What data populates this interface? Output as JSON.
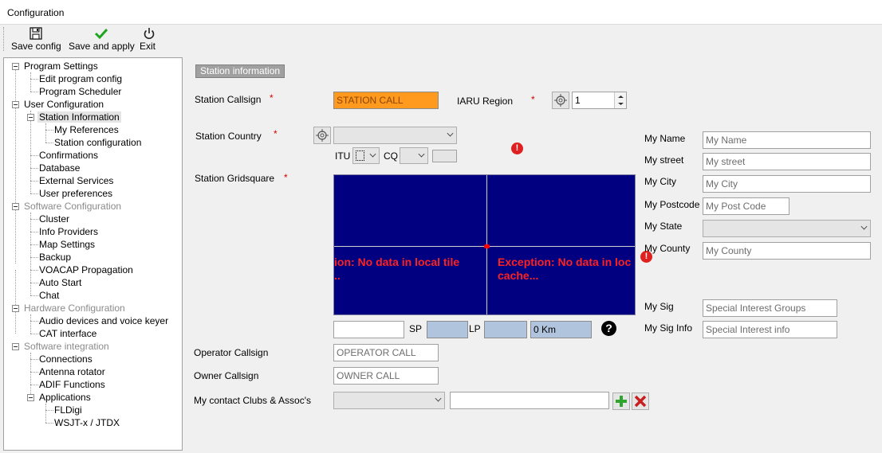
{
  "window": {
    "title": "Configuration"
  },
  "toolbar": {
    "save_config": "Save config",
    "save_apply": "Save and apply",
    "exit": "Exit"
  },
  "tree": {
    "program_settings": "Program Settings",
    "edit_program_config": "Edit program config",
    "program_scheduler": "Program Scheduler",
    "user_configuration": "User Configuration",
    "station_information": "Station Information",
    "my_references": "My References",
    "station_configuration": "Station configuration",
    "confirmations": "Confirmations",
    "database": "Database",
    "external_services": "External Services",
    "user_preferences": "User preferences",
    "software_configuration": "Software Configuration",
    "cluster": "Cluster",
    "info_providers": "Info Providers",
    "map_settings": "Map Settings",
    "backup": "Backup",
    "voacap": "VOACAP Propagation",
    "auto_start": "Auto Start",
    "chat": "Chat",
    "hardware_configuration": "Hardware Configuration",
    "audio_devices": "Audio devices and voice keyer",
    "cat_interface": "CAT interface",
    "software_integration": "Software integration",
    "connections": "Connections",
    "antenna_rotator": "Antenna rotator",
    "adif_functions": "ADIF Functions",
    "applications": "Applications",
    "fldigi": "FLDigi",
    "wsjtx": "WSJT-x / JTDX"
  },
  "form": {
    "section_title": "Station information",
    "callsign_label": "Station Callsign",
    "callsign_value": "STATION CALL",
    "iaru_label": "IARU Region",
    "iaru_value": "1",
    "country_label": "Station Country",
    "itu_label": "ITU",
    "cq_label": "CQ",
    "gridsquare_label": "Station Gridsquare",
    "map_exception_left_1": "ion: No data in local tile",
    "map_exception_left_2": "..",
    "map_exception_right_1": "Exception: No data in loc",
    "map_exception_right_2": "cache...",
    "sp_label": "SP",
    "lp_label": "LP",
    "distance_value": "0 Km",
    "help_glyph": "?",
    "operator_label": "Operator Callsign",
    "operator_placeholder": "OPERATOR CALL",
    "owner_label": "Owner Callsign",
    "owner_placeholder": "OWNER CALL",
    "clubs_label": "My contact Clubs & Assoc's",
    "required_mark": "*"
  },
  "personal": {
    "name_label": "My Name",
    "name_placeholder": "My Name",
    "street_label": "My street",
    "street_placeholder": "My street",
    "city_label": "My City",
    "city_placeholder": "My City",
    "postcode_label": "My Postcode",
    "postcode_placeholder": "My Post Code",
    "state_label": "My State",
    "county_label": "My County",
    "county_placeholder": "My County",
    "sig_label": "My Sig",
    "sig_placeholder": "Special Interest Groups",
    "siginfo_label": "My Sig Info",
    "siginfo_placeholder": "Special Interest info"
  },
  "colors": {
    "callsign_bg": "#ff9a1f",
    "map_bg": "#000080",
    "exception_text": "#ff2020",
    "required": "#d40000"
  },
  "icons": {
    "save": "floppy-disk-icon",
    "apply": "green-check-icon",
    "exit": "power-icon",
    "locate": "crosshair-icon",
    "error": "error-icon",
    "help": "help-icon",
    "add": "green-plus-icon",
    "delete": "red-x-icon"
  }
}
